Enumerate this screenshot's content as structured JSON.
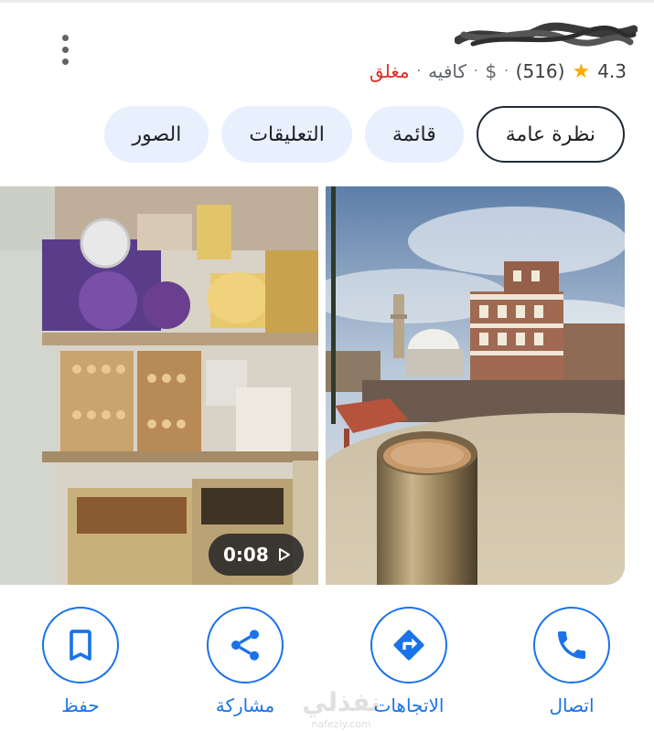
{
  "place": {
    "rating": "4.3",
    "rating_icon": "star-icon",
    "review_count": "(516)",
    "price": "$",
    "category": "كافيه",
    "status": "مغلق",
    "separator": "·"
  },
  "tabs": [
    {
      "label": "نظرة عامة",
      "active": true
    },
    {
      "label": "قائمة",
      "active": false
    },
    {
      "label": "التعليقات",
      "active": false
    },
    {
      "label": "الصور",
      "active": false
    }
  ],
  "media": {
    "video_duration": "0:08",
    "photo_right": "tea-cup-old-city-photo",
    "photo_left": "shop-shelves-video-thumbnail"
  },
  "actions": [
    {
      "label": "اتصال",
      "icon": "phone-icon"
    },
    {
      "label": "الاتجاهات",
      "icon": "directions-icon"
    },
    {
      "label": "مشاركة",
      "icon": "share-icon"
    },
    {
      "label": "حفظ",
      "icon": "bookmark-icon"
    }
  ],
  "watermark": {
    "text": "نفذلي",
    "subtext": "nafezly.com"
  },
  "colors": {
    "accent": "#1a73e8",
    "star": "#f9ab00",
    "closed": "#d93025",
    "chip": "#e8f0fe"
  }
}
